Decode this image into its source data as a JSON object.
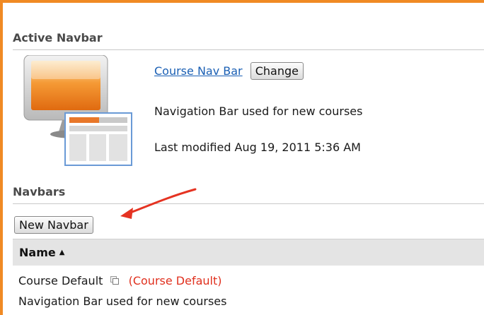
{
  "active_section": {
    "title": "Active Navbar",
    "navbar_link": "Course Nav Bar",
    "change_button": "Change",
    "description": "Navigation Bar used for new courses",
    "last_modified": "Last modified Aug 19, 2011 5:36 AM"
  },
  "navbars_section": {
    "title": "Navbars",
    "new_button": "New Navbar"
  },
  "table": {
    "header_name": "Name",
    "sort_indicator": "▲",
    "rows": [
      {
        "name": "Course Default",
        "tag": "(Course Default)",
        "description": "Navigation Bar used for new courses"
      }
    ]
  },
  "colors": {
    "frame_border": "#f08a24",
    "link": "#1a5fb4",
    "tag_red": "#e0301e",
    "annotation_arrow": "#e53322"
  },
  "icons": [
    "monitor-navbar-icon",
    "copy-icon",
    "annotation-arrow-icon"
  ]
}
